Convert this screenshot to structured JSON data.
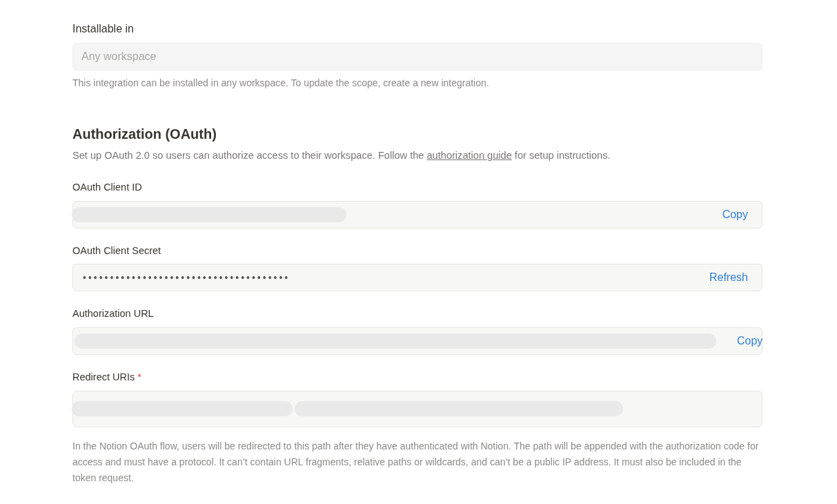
{
  "installable": {
    "label": "Installable in",
    "placeholder": "Any workspace",
    "hint": "This integration can be installed in any workspace. To update the scope, create a new integration."
  },
  "oauth": {
    "heading": "Authorization (OAuth)",
    "description_before": "Set up OAuth 2.0 so users can authorize access to their workspace. Follow the",
    "link": "authorization guide",
    "description_after": "for setup instructions.",
    "fields": [
      {
        "kind": "copy",
        "label": "OAuth Client ID",
        "action": "Copy"
      },
      {
        "kind": "secret",
        "label": "OAuth Client Secret",
        "value": "••••••••••••••••••••••••••••••••••••••",
        "action": "Refresh"
      },
      {
        "kind": "copy-long",
        "label": "Authorization URL",
        "action": "Copy"
      },
      {
        "kind": "uris",
        "label": "Redirect URIs",
        "required_mark": "*"
      }
    ],
    "hint": "In the Notion OAuth flow, users will be redirected to this path after they have authenticated with Notion. The path will be appended with the authorization code for access and must have a protocol. It can’t contain URL fragments, relative paths or wildcards, and can’t be a public IP address. It must also be included in the token request."
  }
}
